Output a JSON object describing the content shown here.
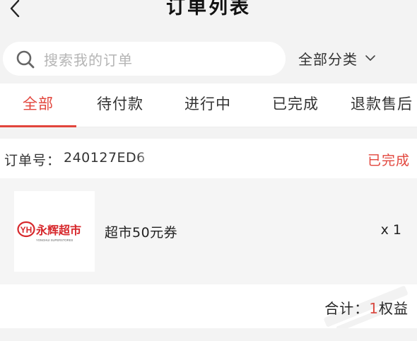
{
  "header": {
    "title": "订单列表",
    "back_icon": "back-arrow-icon"
  },
  "search": {
    "placeholder": "搜索我的订单",
    "icon": "search-icon"
  },
  "filter": {
    "label": "全部分类",
    "icon": "chevron-down-icon"
  },
  "tabs": [
    {
      "label": "全部",
      "active": true
    },
    {
      "label": "待付款",
      "active": false
    },
    {
      "label": "进行中",
      "active": false
    },
    {
      "label": "已完成",
      "active": false
    },
    {
      "label": "退款售后",
      "active": false
    }
  ],
  "order": {
    "number_label": "订单号：",
    "number_value": "240127ED6",
    "status": "已完成",
    "item": {
      "name": "超市50元券",
      "quantity": "x 1",
      "logo": {
        "badge": "YH",
        "brand": "永辉超市",
        "subtitle": "YONGHUI SUPERSTORES"
      }
    },
    "total": {
      "prefix": "合计：",
      "amount": "1",
      "unit": "权益"
    }
  },
  "colors": {
    "accent": "#e2453c",
    "background": "#f3f3f3",
    "card": "#ffffff"
  }
}
